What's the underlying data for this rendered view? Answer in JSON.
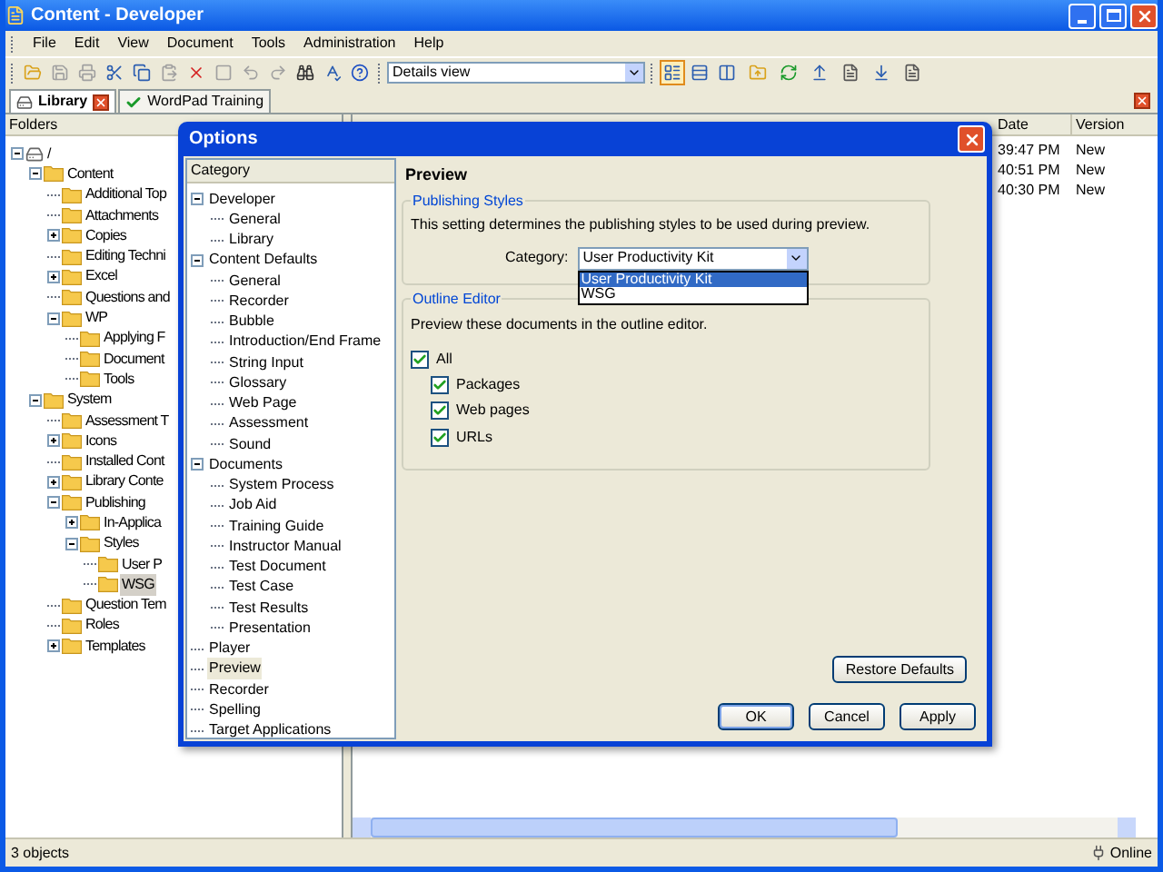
{
  "window": {
    "title": "Content - Developer"
  },
  "menu": [
    "File",
    "Edit",
    "View",
    "Document",
    "Tools",
    "Administration",
    "Help"
  ],
  "toolbar": {
    "view_select": "Details view",
    "view_buttons": [
      {
        "selected": true
      },
      {
        "selected": false
      },
      {
        "selected": false
      }
    ]
  },
  "tabs": [
    {
      "label": "Library",
      "selected": true
    },
    {
      "label": "WordPad Training",
      "selected": false
    }
  ],
  "folders": {
    "header": "Folders",
    "tree": [
      {
        "label": "/",
        "kind": "drive",
        "expanded": true,
        "selected": false,
        "children": [
          {
            "label": "Content",
            "expanded": true,
            "selected": false,
            "children": [
              {
                "label": "Additional Top",
                "selected": false
              },
              {
                "label": "Attachments",
                "selected": false
              },
              {
                "label": "Copies",
                "expanded": false,
                "selected": false
              },
              {
                "label": "Editing Techni",
                "selected": false
              },
              {
                "label": "Excel",
                "expanded": false,
                "selected": false
              },
              {
                "label": "Questions and",
                "selected": false
              },
              {
                "label": "WP",
                "expanded": true,
                "selected": false,
                "children": [
                  {
                    "label": "Applying F",
                    "selected": false
                  },
                  {
                    "label": "Document",
                    "selected": false
                  },
                  {
                    "label": "Tools",
                    "selected": false
                  }
                ]
              }
            ]
          },
          {
            "label": "System",
            "expanded": true,
            "selected": false,
            "children": [
              {
                "label": "Assessment T",
                "selected": false
              },
              {
                "label": "Icons",
                "expanded": false,
                "selected": false
              },
              {
                "label": "Installed Cont",
                "selected": false
              },
              {
                "label": "Library Conte",
                "expanded": false,
                "selected": false
              },
              {
                "label": "Publishing",
                "expanded": true,
                "selected": false,
                "children": [
                  {
                    "label": "In-Applica",
                    "expanded": false,
                    "selected": false
                  },
                  {
                    "label": "Styles",
                    "expanded": true,
                    "selected": false,
                    "children": [
                      {
                        "label": "User P",
                        "selected": false
                      },
                      {
                        "label": "WSG",
                        "selected": true
                      }
                    ]
                  }
                ]
              },
              {
                "label": "Question Tem",
                "selected": false
              },
              {
                "label": "Roles",
                "selected": false
              },
              {
                "label": "Templates",
                "expanded": false,
                "selected": false
              }
            ]
          }
        ]
      }
    ]
  },
  "list": {
    "columns": [
      "Date",
      "Version"
    ],
    "rows": [
      [
        "39:47 PM",
        "New"
      ],
      [
        "40:51 PM",
        "New"
      ],
      [
        "40:30 PM",
        "New"
      ]
    ]
  },
  "options_dialog": {
    "title": "Options",
    "category_header": "Category",
    "categories": [
      {
        "label": "Developer",
        "expanded": true,
        "selected": false,
        "children": [
          {
            "label": "General",
            "selected": false
          },
          {
            "label": "Library",
            "selected": false
          }
        ]
      },
      {
        "label": "Content Defaults",
        "expanded": true,
        "selected": false,
        "children": [
          {
            "label": "General",
            "selected": false
          },
          {
            "label": "Recorder",
            "selected": false
          },
          {
            "label": "Bubble",
            "selected": false
          },
          {
            "label": "Introduction/End Frame",
            "selected": false
          },
          {
            "label": "String Input",
            "selected": false
          },
          {
            "label": "Glossary",
            "selected": false
          },
          {
            "label": "Web Page",
            "selected": false
          },
          {
            "label": "Assessment",
            "selected": false
          },
          {
            "label": "Sound",
            "selected": false
          }
        ]
      },
      {
        "label": "Documents",
        "expanded": true,
        "selected": false,
        "children": [
          {
            "label": "System Process",
            "selected": false
          },
          {
            "label": "Job Aid",
            "selected": false
          },
          {
            "label": "Training Guide",
            "selected": false
          },
          {
            "label": "Instructor Manual",
            "selected": false
          },
          {
            "label": "Test Document",
            "selected": false
          },
          {
            "label": "Test Case",
            "selected": false
          },
          {
            "label": "Test Results",
            "selected": false
          },
          {
            "label": "Presentation",
            "selected": false
          }
        ]
      },
      {
        "label": "Player",
        "selected": false
      },
      {
        "label": "Preview",
        "selected": true
      },
      {
        "label": "Recorder",
        "selected": false
      },
      {
        "label": "Spelling",
        "selected": false
      },
      {
        "label": "Target Applications",
        "selected": false
      }
    ],
    "page_title": "Preview",
    "publishing_styles": {
      "legend": "Publishing Styles",
      "description": "This setting determines the publishing styles to be used during preview.",
      "category_label": "Category:",
      "value": "User Productivity Kit",
      "options": [
        {
          "label": "User Productivity Kit",
          "selected": true
        },
        {
          "label": "WSG",
          "selected": false
        }
      ]
    },
    "outline_editor": {
      "legend": "Outline Editor",
      "description": "Preview these documents in the outline editor.",
      "checkboxes": [
        {
          "label": "All",
          "checked": true,
          "children": [
            {
              "label": "Packages",
              "checked": true
            },
            {
              "label": "Web pages",
              "checked": true
            },
            {
              "label": "URLs",
              "checked": true
            }
          ]
        }
      ]
    },
    "restore_button": "Restore Defaults",
    "buttons": [
      "OK",
      "Cancel",
      "Apply"
    ]
  },
  "status_bar": {
    "text": "3 objects",
    "connection": "Online"
  }
}
